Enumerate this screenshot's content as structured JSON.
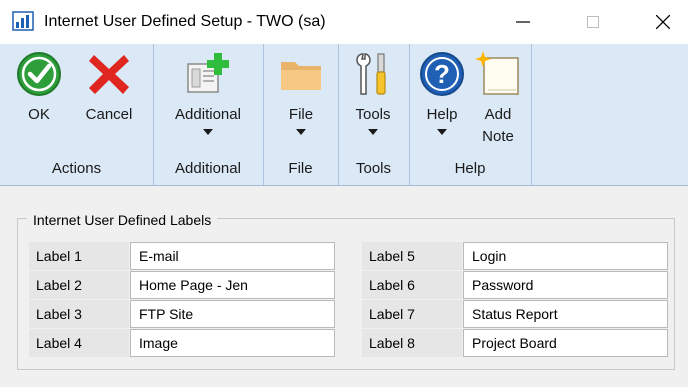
{
  "window": {
    "title": "Internet User Defined Setup  -  TWO (sa)"
  },
  "ribbon": {
    "groups": [
      {
        "caption": "Actions",
        "buttons": [
          {
            "label": "OK",
            "icon": "ok-icon"
          },
          {
            "label": "Cancel",
            "icon": "cancel-icon"
          }
        ]
      },
      {
        "caption": "Additional",
        "buttons": [
          {
            "label": "Additional",
            "icon": "additional-icon"
          }
        ]
      },
      {
        "caption": "File",
        "buttons": [
          {
            "label": "File",
            "icon": "folder-icon"
          }
        ]
      },
      {
        "caption": "Tools",
        "buttons": [
          {
            "label": "Tools",
            "icon": "tools-icon"
          }
        ]
      },
      {
        "caption": "Help",
        "buttons": [
          {
            "label": "Help",
            "icon": "help-icon"
          },
          {
            "label": "Add\nNote",
            "icon": "note-icon"
          }
        ]
      }
    ]
  },
  "labels_section": {
    "title": "Internet User Defined Labels",
    "rows": [
      {
        "label": "Label 1",
        "value": "E-mail"
      },
      {
        "label": "Label 2",
        "value": "Home Page - Jen"
      },
      {
        "label": "Label 3",
        "value": "FTP Site"
      },
      {
        "label": "Label 4",
        "value": "Image"
      },
      {
        "label": "Label 5",
        "value": "Login"
      },
      {
        "label": "Label 6",
        "value": "Password"
      },
      {
        "label": "Label 7",
        "value": "Status Report"
      },
      {
        "label": "Label 8",
        "value": "Project Board"
      }
    ]
  },
  "colors": {
    "ribbon_bg": "#dbe8f6",
    "ok_green": "#2e9e3a",
    "cancel_red": "#e0271f",
    "help_blue": "#1f5fb4"
  }
}
